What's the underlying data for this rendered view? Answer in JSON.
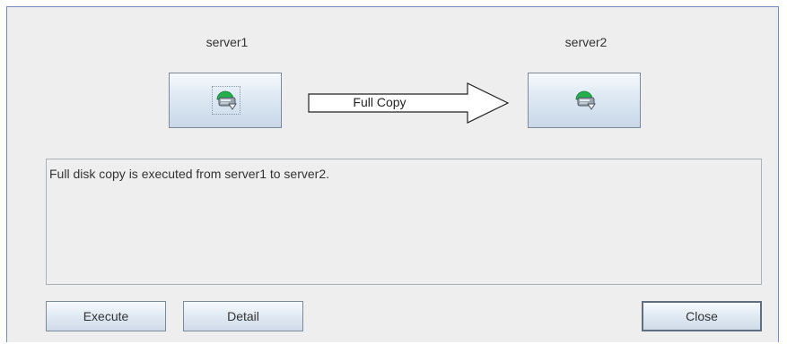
{
  "servers": {
    "source": {
      "name": "server1"
    },
    "target": {
      "name": "server2"
    }
  },
  "operation": {
    "label": "Full Copy"
  },
  "message": {
    "text": "Full disk copy is executed from server1 to server2."
  },
  "buttons": {
    "execute": "Execute",
    "detail": "Detail",
    "close": "Close"
  },
  "icons": {
    "server_icon": "server-disk-status-icon",
    "status_color": "#22b14c"
  },
  "colors": {
    "dialog_background": "#eeeeee",
    "dialog_border": "#6f8fbf",
    "button_gradient_top": "#f5f9fd",
    "button_gradient_bottom": "#c9d8e8"
  }
}
